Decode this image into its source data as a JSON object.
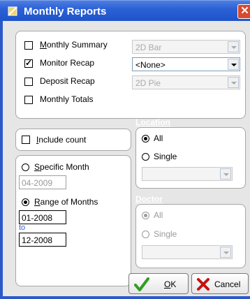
{
  "window": {
    "title": "Monthly Reports",
    "close_glyph": "✕"
  },
  "reports": [
    {
      "label": "Monthly Summary",
      "checked": false,
      "chart": "2D Bar",
      "chart_enabled": false
    },
    {
      "label": "Monitor Recap",
      "checked": true,
      "chart": "<None>",
      "chart_enabled": true
    },
    {
      "label": "Deposit Recap",
      "checked": false,
      "chart": "2D Pie",
      "chart_enabled": false
    },
    {
      "label": "Monthly Totals",
      "checked": false
    }
  ],
  "options": {
    "include_count_label": "Include count",
    "specific_month_label": "Specific Month",
    "specific_month_value": "04-2009",
    "range_label": "Range of Months",
    "range_from": "01-2008",
    "to_label": "to",
    "range_to": "12-2008",
    "selected": "range"
  },
  "location": {
    "title": "Location",
    "all_label": "All",
    "single_label": "Single",
    "selected": "all",
    "single_value": ""
  },
  "doctor": {
    "title": "Doctor",
    "all_label": "All",
    "single_label": "Single",
    "selected": "all",
    "enabled": false,
    "single_value": ""
  },
  "buttons": {
    "ok": "OK",
    "cancel": "Cancel"
  },
  "icons": {
    "title": "app-icon",
    "ok": "check-icon",
    "cancel": "x-icon"
  },
  "colors": {
    "title_bar": "#2b61d6",
    "close": "#d9492c",
    "group_bg": "#2b59c9",
    "check_green": "#2e9e1e",
    "cancel_red": "#c81010"
  }
}
